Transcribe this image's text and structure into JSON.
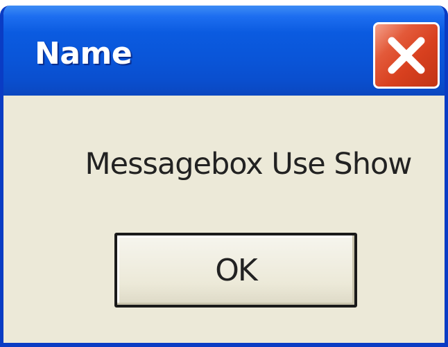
{
  "window": {
    "title": "Name",
    "close_icon": "close-icon"
  },
  "message": {
    "text": "Messagebox Use Show"
  },
  "buttons": {
    "ok_label": "OK"
  },
  "colors": {
    "titlebar": "#0a55d8",
    "frame": "#0a3cc4",
    "client_background": "#ece9d8",
    "close_button": "#d8401f"
  }
}
